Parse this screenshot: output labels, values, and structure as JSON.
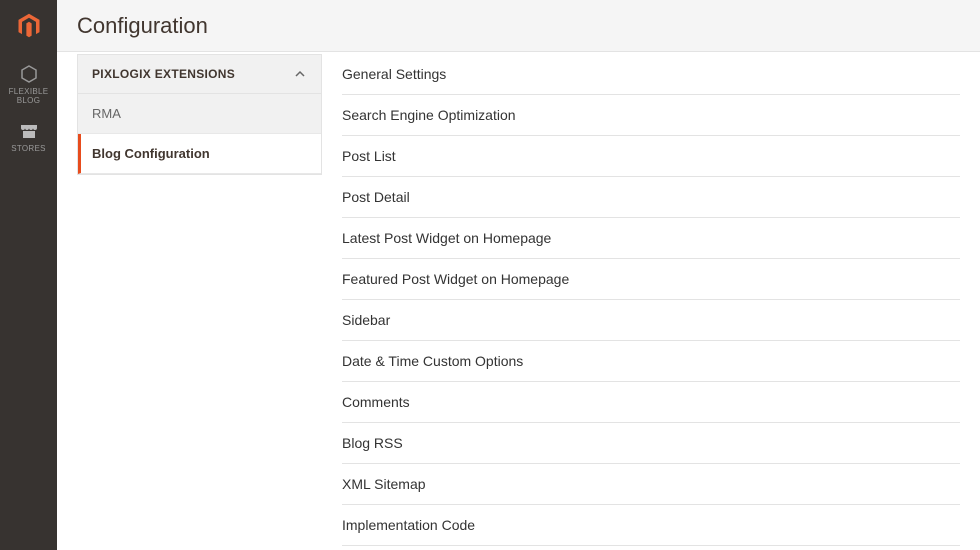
{
  "page": {
    "title": "Configuration"
  },
  "nav": {
    "items": [
      {
        "label": "FLEXIBLE BLOG"
      },
      {
        "label": "STORES"
      }
    ]
  },
  "sidebar": {
    "accordion_title": "PIXLOGIX EXTENSIONS",
    "items": [
      {
        "label": "RMA",
        "active": false
      },
      {
        "label": "Blog Configuration",
        "active": true
      }
    ]
  },
  "settings": {
    "sections": [
      {
        "label": "General Settings"
      },
      {
        "label": "Search Engine Optimization"
      },
      {
        "label": "Post List"
      },
      {
        "label": "Post Detail"
      },
      {
        "label": "Latest Post Widget on Homepage"
      },
      {
        "label": "Featured Post Widget on Homepage"
      },
      {
        "label": "Sidebar"
      },
      {
        "label": "Date & Time Custom Options"
      },
      {
        "label": "Comments"
      },
      {
        "label": "Blog RSS"
      },
      {
        "label": "XML Sitemap"
      },
      {
        "label": "Implementation Code"
      }
    ]
  }
}
